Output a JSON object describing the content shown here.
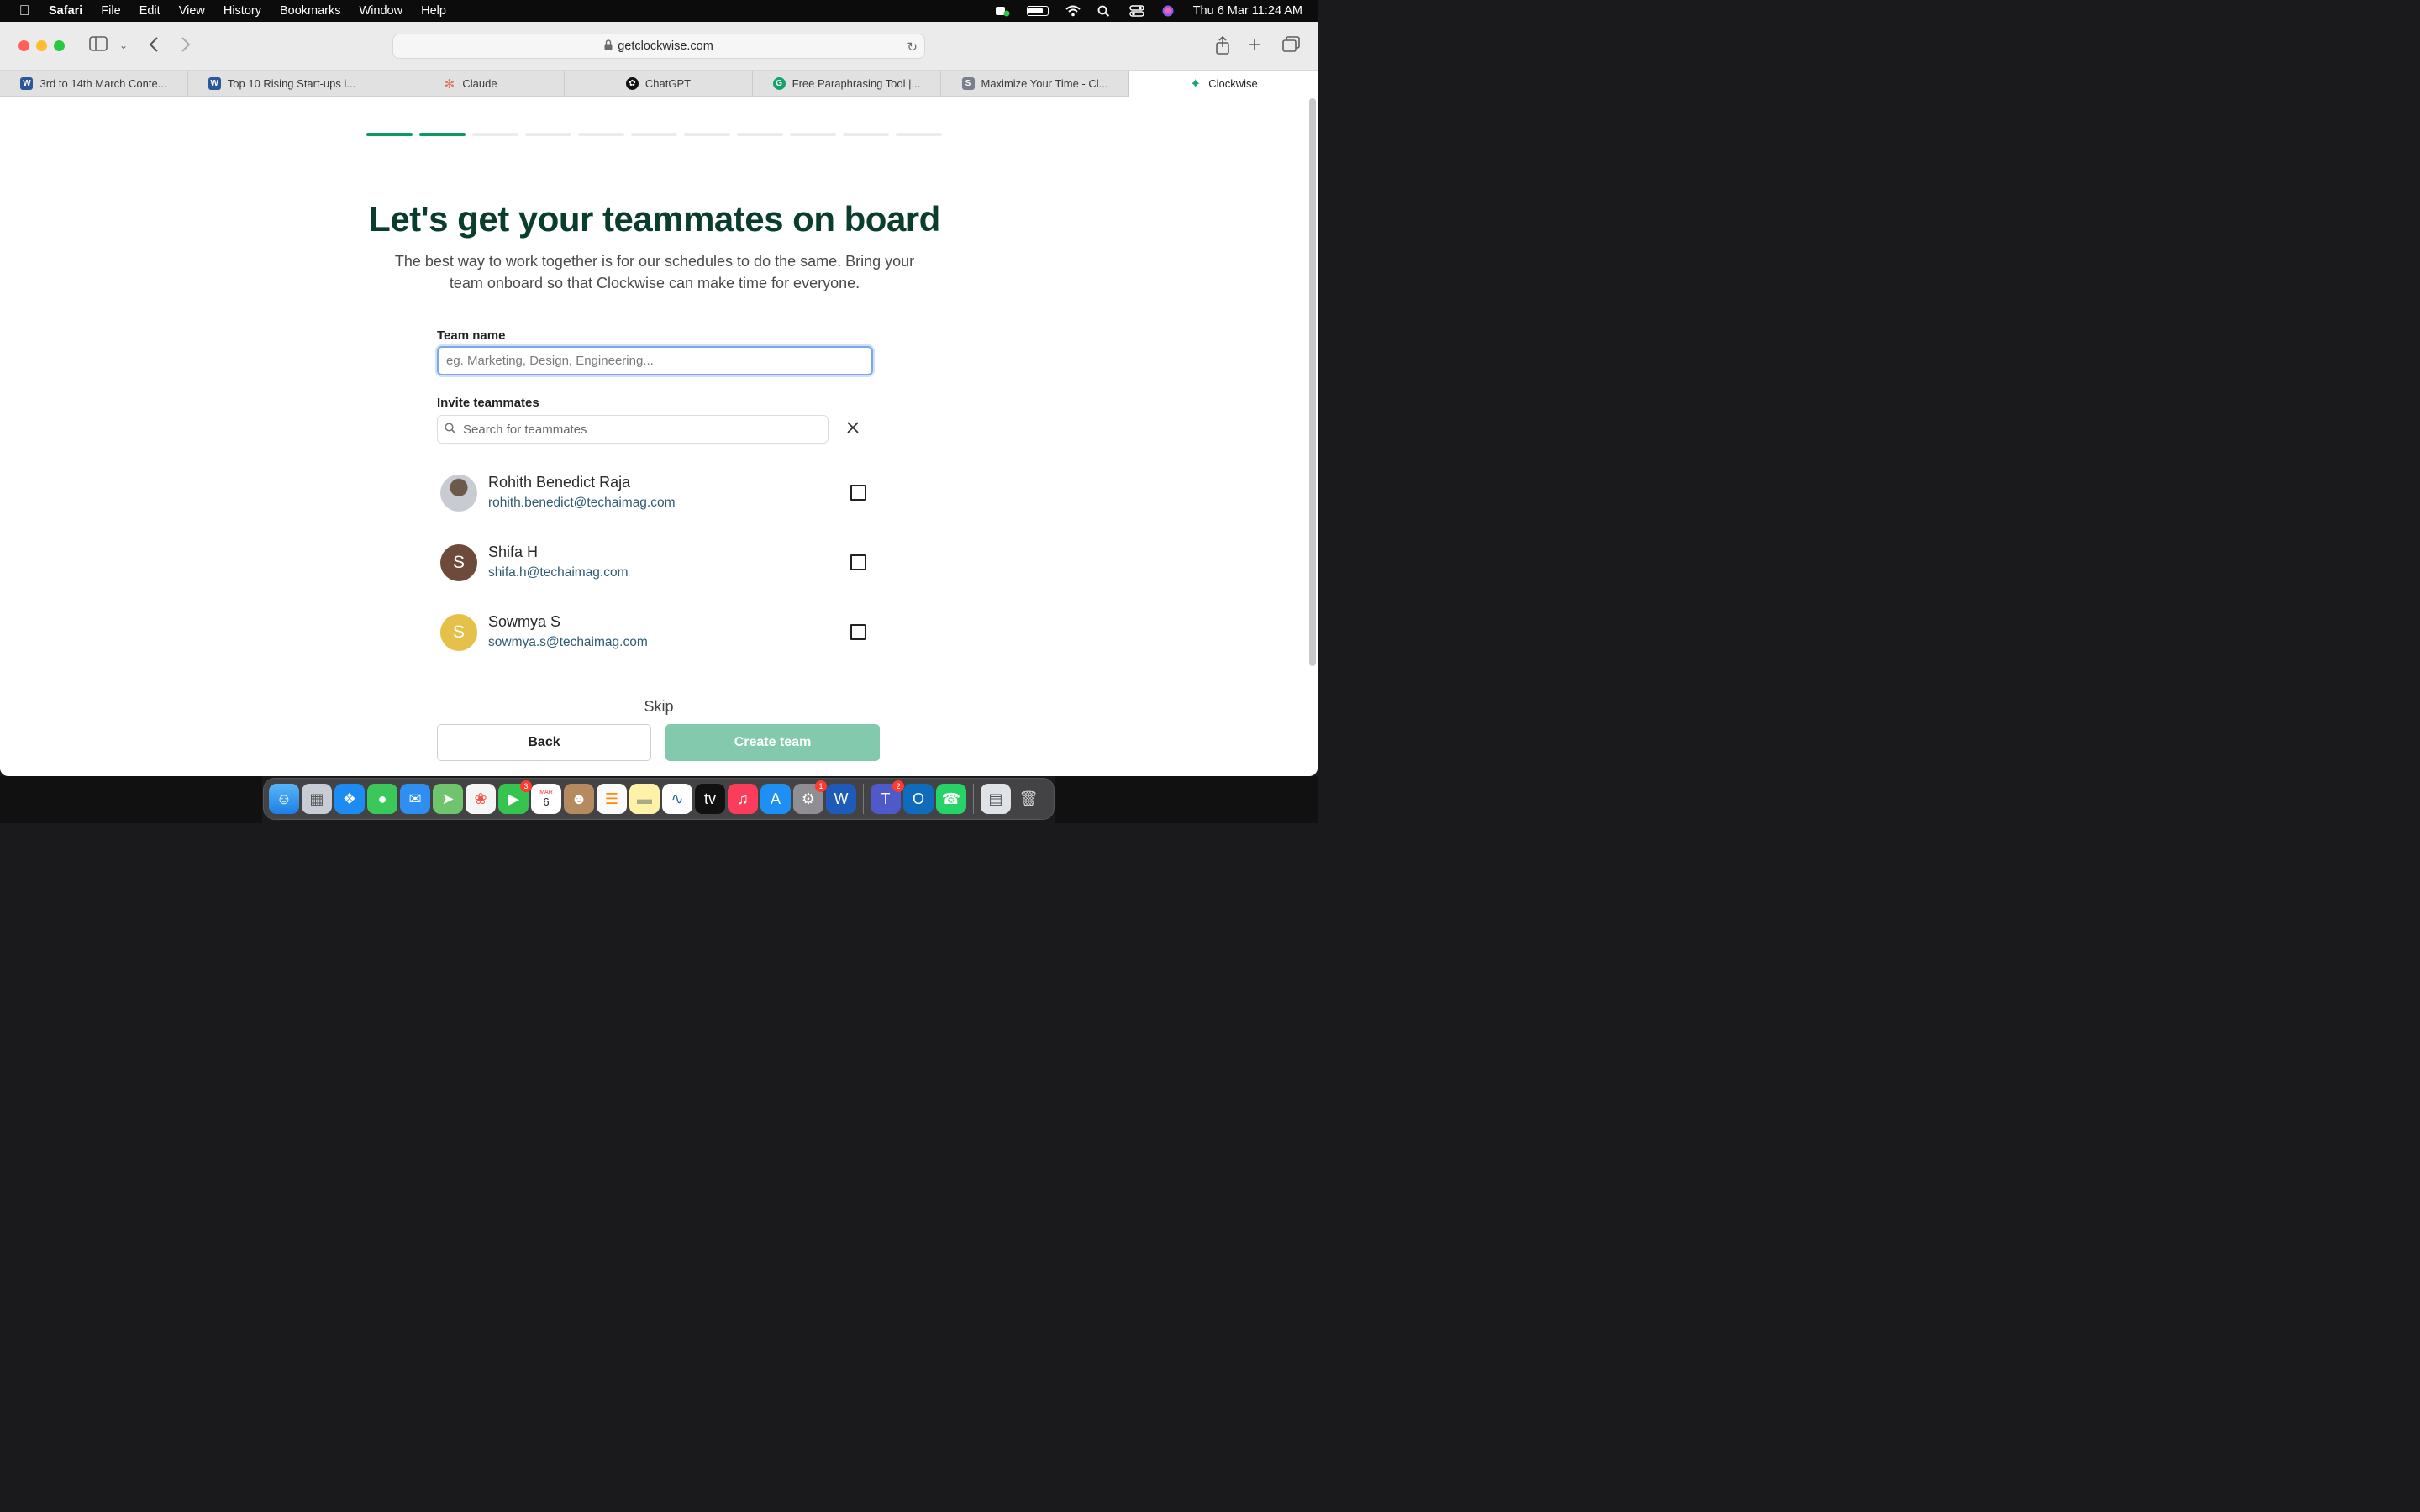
{
  "menubar": {
    "app_name": "Safari",
    "items": [
      "File",
      "Edit",
      "View",
      "History",
      "Bookmarks",
      "Window",
      "Help"
    ],
    "clock": "Thu 6 Mar  11:24 AM"
  },
  "browser": {
    "url": "getclockwise.com",
    "tabs": [
      {
        "label": "3rd to 14th March Conte...",
        "icon": "word-icon"
      },
      {
        "label": "Top 10 Rising Start-ups i...",
        "icon": "word-icon"
      },
      {
        "label": "Claude",
        "icon": "claude-icon"
      },
      {
        "label": "ChatGPT",
        "icon": "chatgpt-icon"
      },
      {
        "label": "Free Paraphrasing Tool |...",
        "icon": "grammarly-icon"
      },
      {
        "label": "Maximize Your Time - Cl...",
        "icon": "s-icon"
      },
      {
        "label": "Clockwise",
        "icon": "clockwise-icon"
      }
    ]
  },
  "onboarding": {
    "progress_done": 2,
    "progress_total": 11,
    "title": "Let's get your teammates on board",
    "subtitle": "The best way to work together is for our schedules to do the same. Bring your team onboard so that Clockwise can make time for everyone.",
    "team_name_label": "Team name",
    "team_name_placeholder": "eg. Marketing, Design, Engineering...",
    "invite_label": "Invite teammates",
    "search_placeholder": "Search for teammates",
    "members": [
      {
        "name": "Rohith Benedict Raja",
        "email": "rohith.benedict@techaimag.com",
        "initial": "",
        "checked": false
      },
      {
        "name": "Shifa H",
        "email": "shifa.h@techaimag.com",
        "initial": "S",
        "checked": false
      },
      {
        "name": "Sowmya S",
        "email": "sowmya.s@techaimag.com",
        "initial": "S",
        "checked": false
      }
    ],
    "skip_label": "Skip",
    "back_label": "Back",
    "create_label": "Create team"
  },
  "dock": {
    "badges": {
      "facetime": "3",
      "calendar_month": "MAR",
      "calendar_day": "6",
      "settings": "1",
      "teams": "2"
    }
  },
  "colors": {
    "accent": "#0c9a62",
    "title": "#0b3d2e",
    "create_button": "#82c9ae"
  }
}
